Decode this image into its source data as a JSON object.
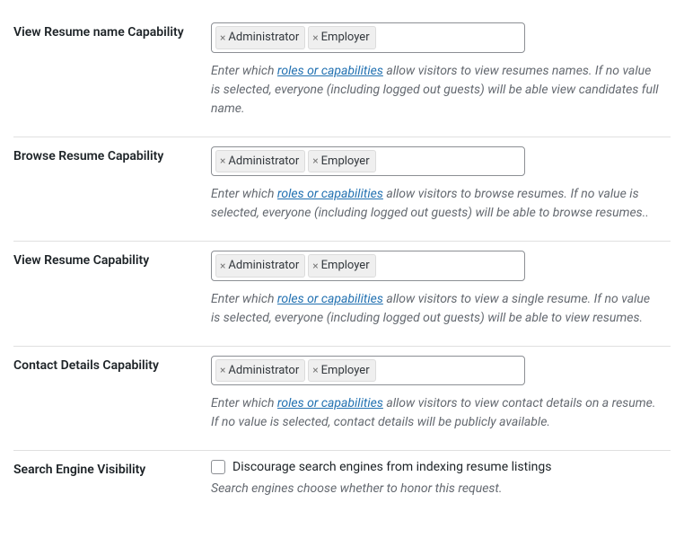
{
  "fields": {
    "view_resume_name": {
      "label": "View Resume name Capability",
      "tags": [
        "Administrator",
        "Employer"
      ],
      "desc_prefix": "Enter which ",
      "desc_link": "roles or capabilities",
      "desc_suffix": " allow visitors to view resumes names. If no value is selected, everyone (including logged out guests) will be able view candidates full name."
    },
    "browse_resume": {
      "label": "Browse Resume Capability",
      "tags": [
        "Administrator",
        "Employer"
      ],
      "desc_prefix": "Enter which ",
      "desc_link": "roles or capabilities",
      "desc_suffix": " allow visitors to browse resumes. If no value is selected, everyone (including logged out guests) will be able to browse resumes.."
    },
    "view_resume": {
      "label": "View Resume Capability",
      "tags": [
        "Administrator",
        "Employer"
      ],
      "desc_prefix": "Enter which ",
      "desc_link": "roles or capabilities",
      "desc_suffix": " allow visitors to view a single resume. If no value is selected, everyone (including logged out guests) will be able to view resumes."
    },
    "contact_details": {
      "label": "Contact Details Capability",
      "tags": [
        "Administrator",
        "Employer"
      ],
      "desc_prefix": "Enter which ",
      "desc_link": "roles or capabilities",
      "desc_suffix": " allow visitors to view contact details on a resume. If no value is selected, contact details will be publicly available."
    },
    "search_engine": {
      "label": "Search Engine Visibility",
      "checkbox_label": "Discourage search engines from indexing resume listings",
      "desc": "Search engines choose whether to honor this request."
    }
  }
}
